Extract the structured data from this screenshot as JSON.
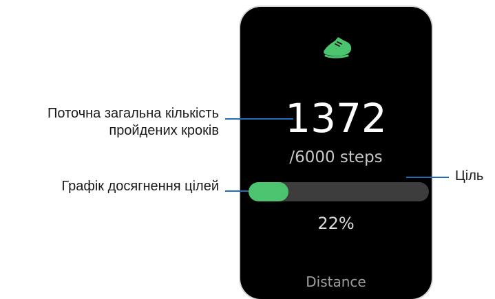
{
  "watch": {
    "icon": "shoe-icon",
    "steps_current": "1372",
    "steps_goal": "/6000 steps",
    "progress_fraction": 0.22,
    "progress_percent_label": "22%",
    "next_item_label": "Distance",
    "accent_color": "#4cc36f"
  },
  "callouts": {
    "current_steps_line1": "Поточна загальна кількість",
    "current_steps_line2": "пройдених кроків",
    "goal": "Ціль",
    "graph": "Графік досягнення цілей",
    "leader_color": "#1f6fb8"
  }
}
